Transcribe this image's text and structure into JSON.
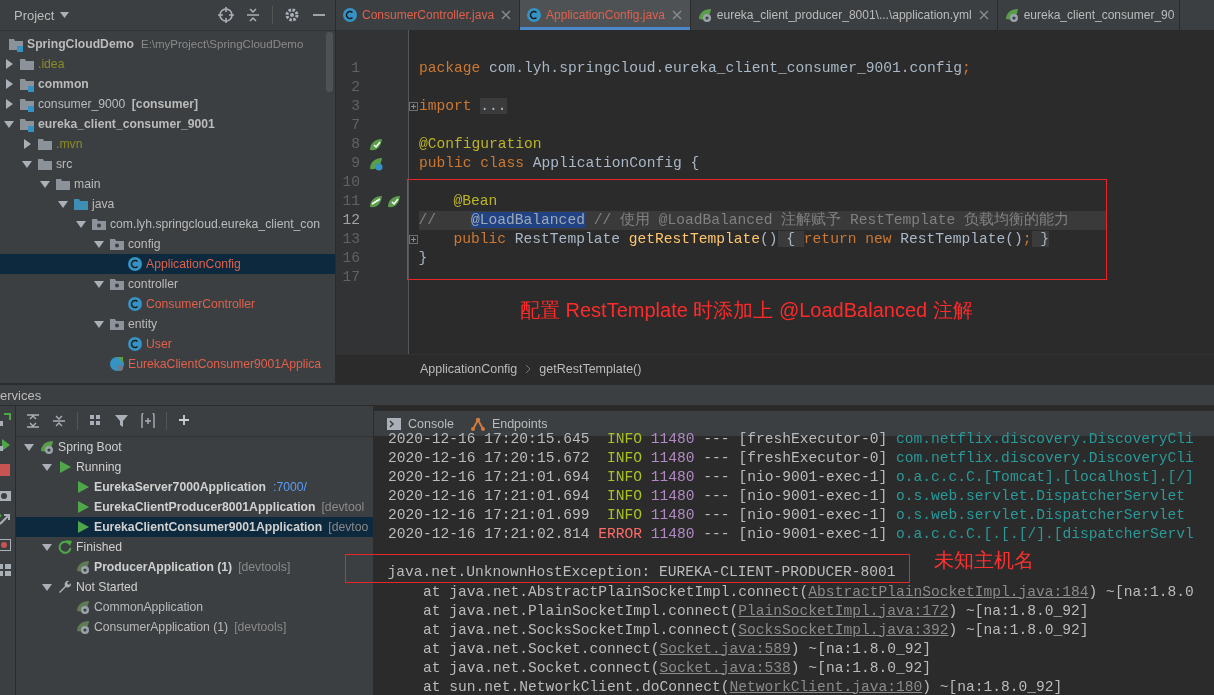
{
  "project_panel": {
    "title": "Project",
    "tree": [
      {
        "label": "SpringCloudDemo",
        "kind": "module",
        "bold": true,
        "path": "E:\\myProject\\SpringCloudDemo",
        "selected": false,
        "children": [
          {
            "label": ".idea",
            "kind": "folder",
            "expanded": false,
            "color": "#8c8c24",
            "selected": false
          },
          {
            "label": "common",
            "kind": "module",
            "bold": true,
            "expanded": false,
            "selected": false
          },
          {
            "label": "consumer_9000",
            "kind": "module",
            "tag": "[consumer]",
            "expanded": false,
            "selected": false
          },
          {
            "label": "eureka_client_consumer_9001",
            "kind": "module",
            "bold": true,
            "expanded": true,
            "selected": false,
            "children": [
              {
                "label": ".mvn",
                "kind": "folder",
                "expanded": false,
                "color": "#8c8c24",
                "selected": false
              },
              {
                "label": "src",
                "kind": "folder",
                "expanded": true,
                "selected": false,
                "children": [
                  {
                    "label": "main",
                    "kind": "folder",
                    "expanded": true,
                    "selected": false,
                    "children": [
                      {
                        "label": "java",
                        "kind": "source-folder",
                        "expanded": true,
                        "selected": false,
                        "children": [
                          {
                            "label": "com.lyh.springcloud.eureka_client_con",
                            "kind": "package",
                            "expanded": true,
                            "selected": false,
                            "children": [
                              {
                                "label": "config",
                                "kind": "package",
                                "expanded": true,
                                "selected": false,
                                "children": [
                                  {
                                    "label": "ApplicationConfig",
                                    "kind": "class",
                                    "color": "#e0604c",
                                    "selected": true
                                  }
                                ]
                              },
                              {
                                "label": "controller",
                                "kind": "package",
                                "expanded": true,
                                "selected": false,
                                "children": [
                                  {
                                    "label": "ConsumerController",
                                    "kind": "class",
                                    "color": "#e0604c",
                                    "selected": false
                                  }
                                ]
                              },
                              {
                                "label": "entity",
                                "kind": "package",
                                "expanded": true,
                                "selected": false,
                                "children": [
                                  {
                                    "label": "User",
                                    "kind": "class",
                                    "color": "#e0604c",
                                    "selected": false
                                  }
                                ]
                              },
                              {
                                "label": "EurekaClientConsumer9001Applica",
                                "kind": "spring-class",
                                "color": "#e0604c",
                                "selected": false
                              }
                            ]
                          }
                        ]
                      }
                    ]
                  }
                ]
              }
            ]
          }
        ]
      }
    ]
  },
  "editor": {
    "tabs": [
      {
        "label": "ConsumerController.java",
        "kind": "class",
        "selected": false
      },
      {
        "label": "ApplicationConfig.java",
        "kind": "class",
        "selected": true
      },
      {
        "label": "eureka_client_producer_8001\\...\\application.yml",
        "kind": "yml",
        "selected": false
      },
      {
        "label": "eureka_client_consumer_90",
        "kind": "yml",
        "selected": false
      }
    ],
    "code": [
      {
        "kind": "line",
        "number": "1",
        "current": false,
        "tokens": [
          {
            "keyword": "package"
          },
          {
            "text": " com.lyh.springcloud.eureka_client_consumer_9001.config"
          },
          {
            "keyword": ";"
          }
        ]
      },
      {
        "kind": "line",
        "number": "2",
        "current": false
      },
      {
        "kind": "line",
        "number": "3",
        "current": false,
        "foldable": true,
        "tokens": [
          {
            "keyword": "import "
          },
          {
            "fold": "..."
          }
        ]
      },
      {
        "kind": "line",
        "number": "7",
        "current": false
      },
      {
        "kind": "line",
        "number": "8",
        "current": false,
        "gutter": [
          {
            "kind": "bean-check"
          }
        ],
        "tokens": [
          {
            "annotation": "@Configuration"
          }
        ]
      },
      {
        "kind": "line",
        "number": "9",
        "current": false,
        "gutter": [
          {
            "kind": "bean-search"
          }
        ],
        "tokens": [
          {
            "keyword": "public class"
          },
          {
            "text": " ApplicationConfig {"
          }
        ]
      },
      {
        "kind": "line",
        "number": "10",
        "current": false
      },
      {
        "kind": "box",
        "lines": [
          {
            "number": "11",
            "current": false,
            "gutter": [
              {
                "kind": "bean-link"
              },
              {
                "kind": "bean-check"
              }
            ],
            "tokens": [
              {
                "annotation": "    @Bean"
              }
            ]
          },
          {
            "number": "12",
            "current": true,
            "tokens": [
              {
                "comment": "//    "
              },
              {
                "selection": "@LoadBalanced"
              },
              {
                "comment": " // 使用 @LoadBalanced 注解赋予 RestTemplate 负载均衡的能力"
              }
            ]
          },
          {
            "number": "13",
            "current": false,
            "foldable": true,
            "tokens": [
              {
                "keyword": "    public"
              },
              {
                "text": " RestTemplate "
              },
              {
                "method": "getRestTemplate"
              },
              {
                "text": "()"
              },
              {
                "fold": " { "
              },
              {
                "keyword": "return new"
              },
              {
                "text": " RestTemplate()"
              },
              {
                "keyword": ";"
              },
              {
                "fold": " }"
              }
            ]
          },
          {
            "number": "16",
            "current": false,
            "tokens": [
              {
                "text": "}"
              }
            ]
          }
        ]
      },
      {
        "kind": "line",
        "number": "17",
        "current": false
      }
    ],
    "callout": "配置 RestTemplate 时添加上 @LoadBalanced 注解",
    "breadcrumbs": [
      "ApplicationConfig",
      "getRestTemplate()"
    ]
  },
  "services": {
    "title": "ervices",
    "tree": [
      {
        "label": "Spring Boot",
        "kind": "spring",
        "expanded": true,
        "selected": false,
        "children": [
          {
            "label": "Running",
            "kind": "running",
            "expanded": true,
            "selected": false,
            "children": [
              {
                "label": "EurekaServer7000Application",
                "kind": "run-app",
                "bold": true,
                "port": ":7000/",
                "selected": false
              },
              {
                "label": "EurekaClientProducer8001Application",
                "kind": "run-app",
                "bold": true,
                "tag": "[devtool",
                "selected": false
              },
              {
                "label": "EurekaClientConsumer9001Application",
                "kind": "run-app",
                "bold": true,
                "tag": "[devtoo",
                "selected": true
              }
            ]
          },
          {
            "label": "Finished",
            "kind": "finished",
            "expanded": true,
            "selected": false,
            "children": [
              {
                "label": "ProducerApplication (1)",
                "kind": "app",
                "bold": true,
                "tag": "[devtools]",
                "selected": false
              }
            ]
          },
          {
            "label": "Not Started",
            "kind": "not-started",
            "expanded": true,
            "selected": false,
            "children": [
              {
                "label": "CommonApplication",
                "kind": "app",
                "selected": false
              },
              {
                "label": "ConsumerApplication (1)",
                "kind": "app",
                "tag": "[devtools]",
                "selected": false
              }
            ]
          }
        ]
      }
    ]
  },
  "console": {
    "tabs": [
      {
        "label": "Console",
        "kind": "console"
      },
      {
        "label": "Endpoints",
        "kind": "endpoints"
      }
    ],
    "log": [
      {
        "time": "2020-12-16 17:20:15.645",
        "level": "INFO",
        "pid": "11480",
        "sep": "---",
        "thread": "[freshExecutor-0]",
        "logger": "com.netflix.discovery.DiscoveryCli"
      },
      {
        "time": "2020-12-16 17:20:15.672",
        "level": "INFO",
        "pid": "11480",
        "sep": "---",
        "thread": "[freshExecutor-0]",
        "logger": "com.netflix.discovery.DiscoveryCli"
      },
      {
        "time": "2020-12-16 17:21:01.694",
        "level": "INFO",
        "pid": "11480",
        "sep": "---",
        "thread": "[nio-9001-exec-1]",
        "logger": "o.a.c.c.C.[Tomcat].[localhost].[/]"
      },
      {
        "time": "2020-12-16 17:21:01.694",
        "level": "INFO",
        "pid": "11480",
        "sep": "---",
        "thread": "[nio-9001-exec-1]",
        "logger": "o.s.web.servlet.DispatcherServlet"
      },
      {
        "time": "2020-12-16 17:21:01.699",
        "level": "INFO",
        "pid": "11480",
        "sep": "---",
        "thread": "[nio-9001-exec-1]",
        "logger": "o.s.web.servlet.DispatcherServlet"
      },
      {
        "time": "2020-12-16 17:21:02.814",
        "level": "ERROR",
        "pid": "11480",
        "sep": "---",
        "thread": "[nio-9001-exec-1]",
        "logger": "o.a.c.c.C.[.[.[/].[dispatcherServl"
      }
    ],
    "exception": {
      "text": "java.net.UnknownHostException: EUREKA-CLIENT-PRODUCER-8001",
      "callout": "未知主机名"
    },
    "stack": [
      {
        "frame": "at java.net.AbstractPlainSocketImpl.connect(",
        "link": "AbstractPlainSocketImpl.java:184",
        "suffix": ") ~[na:1.8.0"
      },
      {
        "frame": "at java.net.PlainSocketImpl.connect(",
        "link": "PlainSocketImpl.java:172",
        "suffix": ") ~[na:1.8.0_92]"
      },
      {
        "frame": "at java.net.SocksSocketImpl.connect(",
        "link": "SocksSocketImpl.java:392",
        "suffix": ") ~[na:1.8.0_92]"
      },
      {
        "frame": "at java.net.Socket.connect(",
        "link": "Socket.java:589",
        "suffix": ") ~[na:1.8.0_92]"
      },
      {
        "frame": "at java.net.Socket.connect(",
        "link": "Socket.java:538",
        "suffix": ") ~[na:1.8.0_92]"
      },
      {
        "frame": "at sun.net.NetworkClient.doConnect(",
        "link": "NetworkClient.java:180",
        "suffix": ") ~[na:1.8.0_92]"
      }
    ]
  }
}
